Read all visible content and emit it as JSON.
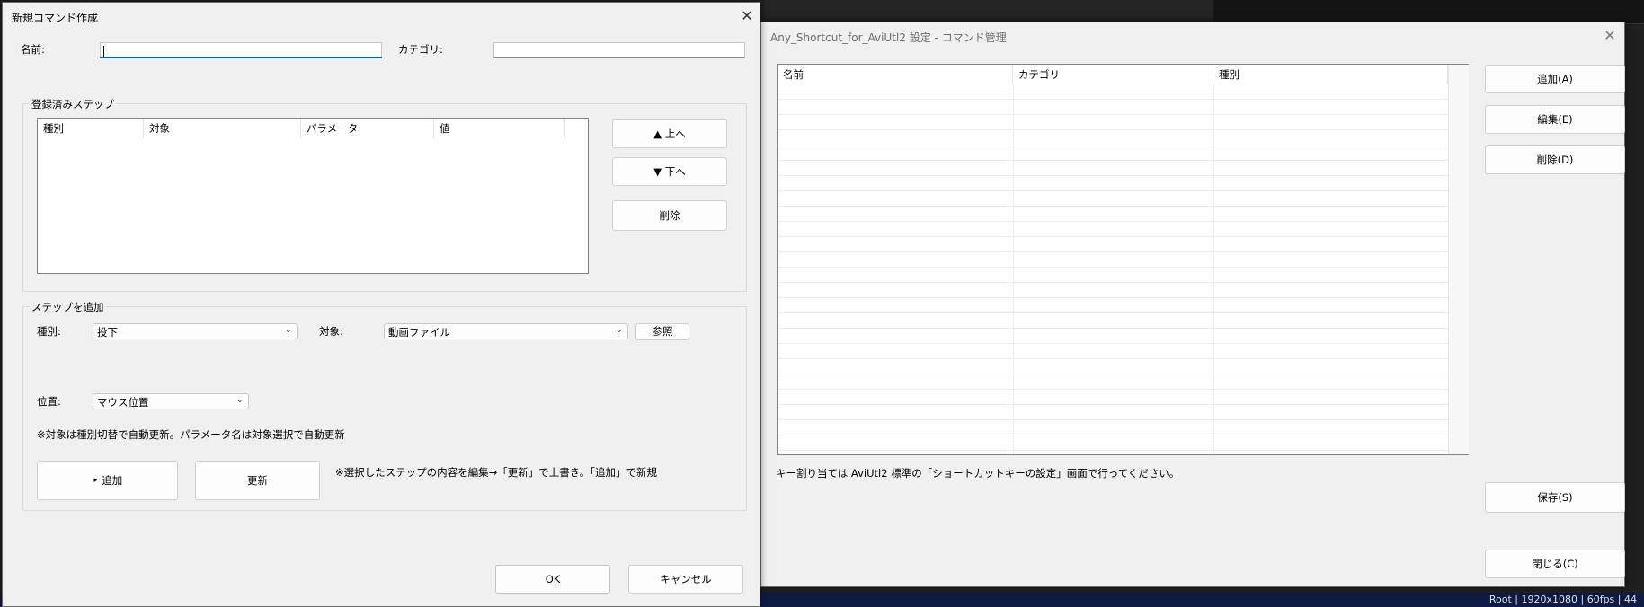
{
  "background": {
    "status_text": "Root | 1920x1080 | 60fps | 44"
  },
  "new_command_dialog": {
    "title": "新規コマンド作成",
    "name_label": "名前:",
    "name_value": "",
    "category_label": "カテゴリ:",
    "category_value": "",
    "registered_steps": {
      "group_title": "登録済みステップ",
      "columns": [
        "種別",
        "対象",
        "パラメータ",
        "値"
      ]
    },
    "step_buttons": {
      "up": "▲ 上へ",
      "down": "▼ 下へ",
      "delete": "削除"
    },
    "add_step": {
      "group_title": "ステップを追加",
      "type_label": "種別:",
      "type_value": "投下",
      "target_label": "対象:",
      "target_value": "動画ファイル",
      "browse_label": "参照",
      "position_label": "位置:",
      "position_value": "マウス位置",
      "note1": "※対象は種別切替で自動更新。パラメータ名は対象選択で自動更新",
      "add_button": "‣ 追加",
      "update_button": "更新",
      "note2": "※選択したステップの内容を編集→「更新」で上書き。「追加」で新規"
    },
    "ok_label": "OK",
    "cancel_label": "キャンセル"
  },
  "command_manager": {
    "title": "Any_Shortcut_for_AviUtl2 設定 - コマンド管理",
    "columns": [
      "名前",
      "カテゴリ",
      "種別"
    ],
    "add_label": "追加(A)",
    "edit_label": "編集(E)",
    "delete_label": "削除(D)",
    "note": "キー割り当ては AviUtl2 標準の「ショートカットキーの設定」画面で行ってください。",
    "save_label": "保存(S)",
    "close_label": "閉じる(C)"
  },
  "icons": {
    "close": "close-icon",
    "dropdown": "chevron-down-icon"
  }
}
